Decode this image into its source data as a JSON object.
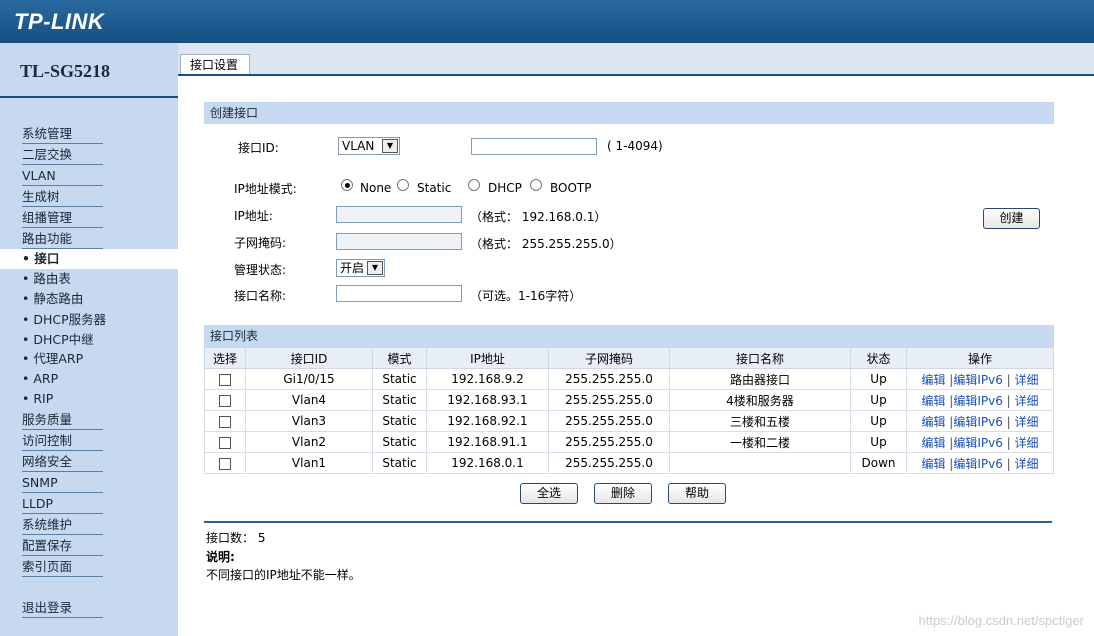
{
  "brand": {
    "logo": "TP-LINK",
    "model": "TL-SG5218"
  },
  "nav": {
    "items": [
      "系统管理",
      "二层交换",
      "VLAN",
      "生成树",
      "组播管理",
      "路由功能"
    ],
    "sub_items": [
      "接口",
      "路由表",
      "静态路由",
      "DHCP服务器",
      "DHCP中继",
      "代理ARP",
      "ARP",
      "RIP"
    ],
    "items2": [
      "服务质量",
      "访问控制",
      "网络安全",
      "SNMP",
      "LLDP",
      "系统维护",
      "配置保存",
      "索引页面"
    ],
    "logout": "退出登录",
    "active": "接口"
  },
  "tab": {
    "label": "接口设置"
  },
  "create": {
    "section_title": "创建接口",
    "id_label": "接口ID:",
    "id_type": "VLAN",
    "id_value": "",
    "id_hint": "( 1-4094)",
    "mode_label": "IP地址模式:",
    "modes": [
      "None",
      "Static",
      "DHCP",
      "BOOTP"
    ],
    "mode_selected": "None",
    "ip_label": "IP地址:",
    "ip_hint": "（格式： 192.168.0.1）",
    "mask_label": "子网掩码:",
    "mask_hint": "（格式： 255.255.255.0）",
    "admin_label": "管理状态:",
    "admin_value": "开启",
    "name_label": "接口名称:",
    "name_hint": "（可选。1-16字符）",
    "create_button": "创建"
  },
  "list": {
    "section_title": "接口列表",
    "headers": [
      "选择",
      "接口ID",
      "模式",
      "IP地址",
      "子网掩码",
      "接口名称",
      "状态",
      "操作"
    ],
    "rows": [
      {
        "id": "Gi1/0/15",
        "mode": "Static",
        "ip": "192.168.9.2",
        "mask": "255.255.255.0",
        "name": "路由器接口",
        "status": "Up"
      },
      {
        "id": "Vlan4",
        "mode": "Static",
        "ip": "192.168.93.1",
        "mask": "255.255.255.0",
        "name": "4楼和服务器",
        "status": "Up"
      },
      {
        "id": "Vlan3",
        "mode": "Static",
        "ip": "192.168.92.1",
        "mask": "255.255.255.0",
        "name": "三楼和五楼",
        "status": "Up"
      },
      {
        "id": "Vlan2",
        "mode": "Static",
        "ip": "192.168.91.1",
        "mask": "255.255.255.0",
        "name": "一楼和二楼",
        "status": "Up"
      },
      {
        "id": "Vlan1",
        "mode": "Static",
        "ip": "192.168.0.1",
        "mask": "255.255.255.0",
        "name": "",
        "status": "Down"
      }
    ],
    "ops": [
      "编辑",
      "编辑IPv6",
      "详细"
    ],
    "buttons": {
      "select_all": "全选",
      "delete": "删除",
      "help": "帮助"
    }
  },
  "footer": {
    "count_label": "接口数：",
    "count": "5",
    "note_title": "说明:",
    "note_text": "不同接口的IP地址不能一样。"
  },
  "watermark": "https://blog.csdn.net/spctiger",
  "colors": {
    "topbar": "#1a5a8f",
    "sidebar": "#c6d9f1",
    "link": "#1a4fb8"
  }
}
